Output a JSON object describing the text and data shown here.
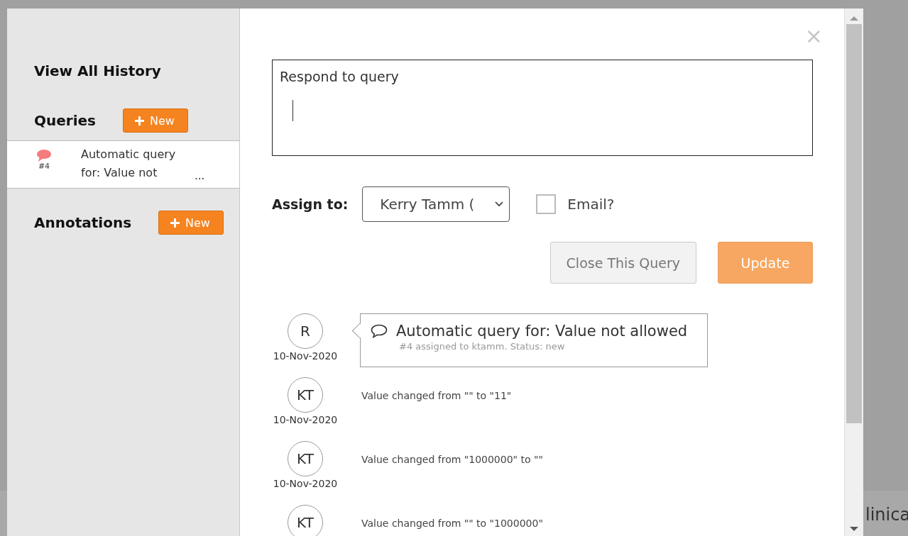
{
  "background": {
    "partial_text": "linica"
  },
  "dialog": {
    "close_label": "×"
  },
  "sidebar": {
    "history_link": "View All History",
    "sections": [
      {
        "title": "Queries",
        "new_button": "New",
        "items": [
          {
            "number": "#4",
            "text": "Automatic query for: Value not",
            "more": "...",
            "selected": true
          }
        ]
      },
      {
        "title": "Annotations",
        "new_button": "New"
      }
    ]
  },
  "response": {
    "label": "Respond to query"
  },
  "assign": {
    "label": "Assign to:",
    "value": "Kerry Tamm (",
    "email_label": "Email?",
    "email_checked": false
  },
  "buttons": [
    {
      "label": "Close This Query",
      "kind": "secondary",
      "disabled": false
    },
    {
      "label": "Update",
      "kind": "primary",
      "disabled": true
    }
  ],
  "timeline": [
    {
      "kind": "query",
      "initials": "R",
      "date": "10-Nov-2020",
      "title": "Automatic query for: Value not allowed",
      "subtitle": "#4 assigned to ktamm. Status: new"
    },
    {
      "kind": "change",
      "initials": "KT",
      "date": "10-Nov-2020",
      "text": "Value changed from \"\" to \"11\""
    },
    {
      "kind": "change",
      "initials": "KT",
      "date": "10-Nov-2020",
      "text": "Value changed from \"1000000\" to \"\""
    },
    {
      "kind": "change",
      "initials": "KT",
      "text": "Value changed from \"\" to \"1000000\""
    }
  ]
}
